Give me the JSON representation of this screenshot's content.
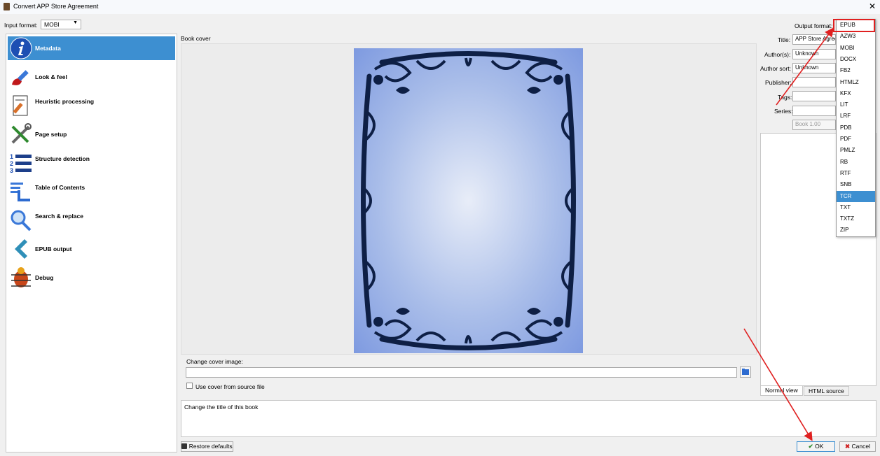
{
  "window": {
    "title": "Convert APP Store Agreement",
    "close_glyph": "✕"
  },
  "input_format": {
    "label": "Input format:",
    "value": "MOBI"
  },
  "sidebar": {
    "items": [
      {
        "label": "Metadata",
        "icon": "info-icon"
      },
      {
        "label": "Look & feel",
        "icon": "paintbrush-icon"
      },
      {
        "label": "Heuristic processing",
        "icon": "document-pen-icon"
      },
      {
        "label": "Page setup",
        "icon": "tools-icon"
      },
      {
        "label": "Structure detection",
        "icon": "numbered-list-icon"
      },
      {
        "label": "Table of Contents",
        "icon": "toc-icon"
      },
      {
        "label": "Search & replace",
        "icon": "magnifier-icon"
      },
      {
        "label": "EPUB output",
        "icon": "chevron-left-icon"
      },
      {
        "label": "Debug",
        "icon": "bug-icon"
      }
    ]
  },
  "cover": {
    "label": "Book cover",
    "change_label": "Change cover image:",
    "path_value": "",
    "use_source_label": "Use cover from source file"
  },
  "metadata": {
    "output_format_label": "Output format:",
    "title_label": "Title:",
    "title_value": "APP Store Agree",
    "authors_label": "Author(s):",
    "authors_value": "Unknown",
    "author_sort_label": "Author sort:",
    "author_sort_value": "Unknown",
    "publisher_label": "Publisher:",
    "publisher_value": "",
    "tags_label": "Tags:",
    "tags_value": "",
    "series_label": "Series:",
    "series_value": "",
    "series_index": "Book 1.00"
  },
  "comment_tabs": {
    "normal": "Normal view",
    "html": "HTML source"
  },
  "description": "Change the title of this book",
  "buttons": {
    "restore": "Restore defaults",
    "ok": "OK",
    "cancel": "Cancel"
  },
  "output_formats": [
    "EPUB",
    "AZW3",
    "MOBI",
    "DOCX",
    "FB2",
    "HTMLZ",
    "KFX",
    "LIT",
    "LRF",
    "PDB",
    "PDF",
    "PMLZ",
    "RB",
    "RTF",
    "SNB",
    "TCR",
    "TXT",
    "TXTZ",
    "ZIP"
  ],
  "output_format_highlighted": "TCR",
  "colors": {
    "accent": "#3d8fd1",
    "annotation_red": "#e02020",
    "cover_ornament": "#0e1f45"
  }
}
